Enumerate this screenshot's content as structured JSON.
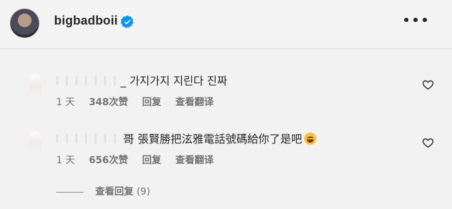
{
  "post": {
    "username": "bigbadboii",
    "more_label": "•••"
  },
  "comments": [
    {
      "text": "_ 가지가지 지린다 진짜",
      "time": "1 天",
      "likes": "348次赞",
      "reply_label": "回复",
      "translate_label": "查看翻译"
    },
    {
      "text": "哥 張賢勝把泫雅電話號碼給你了是吧",
      "time": "1 天",
      "likes": "656次赞",
      "reply_label": "回复",
      "translate_label": "查看翻译"
    }
  ],
  "view_replies": {
    "label": "查看回复",
    "count": "(9)"
  },
  "colors": {
    "verified": "#0095f6",
    "text": "#262626",
    "secondary": "#737373"
  }
}
